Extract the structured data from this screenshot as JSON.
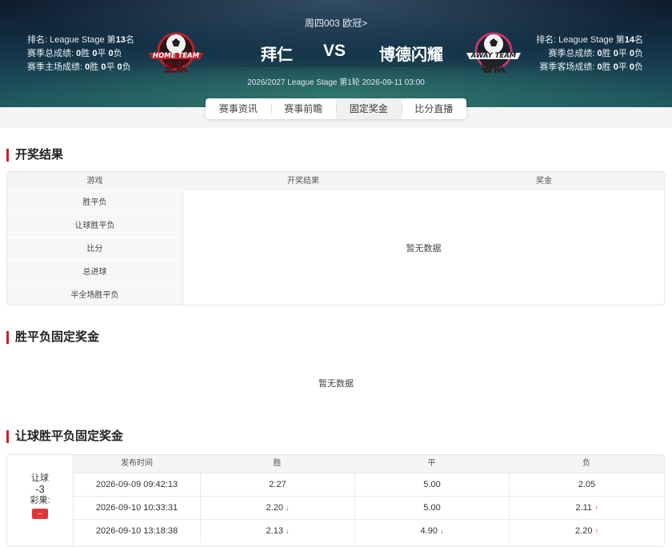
{
  "match": {
    "competition_line": "周四003 欧冠>",
    "home_team": "拜仁",
    "vs": "VS",
    "away_team": "博德闪耀",
    "date_line": "2026/2027 League Stage 第1轮 2026-09-11 03:00",
    "home_info": {
      "rank_prefix": "排名: League Stage 第",
      "rank": "13",
      "rank_suffix": "名",
      "season_label": "赛季总成绩: ",
      "season_w": "0",
      "season_d": "0",
      "season_l": "0",
      "venue_label": "赛季主场成绩: ",
      "venue_w": "0",
      "venue_d": "0",
      "venue_l": "0"
    },
    "away_info": {
      "rank_prefix": "排名: League Stage 第",
      "rank": "14",
      "rank_suffix": "名",
      "season_label": "赛季总成绩: ",
      "season_w": "0",
      "season_d": "0",
      "season_l": "0",
      "venue_label": "赛季客场成绩: ",
      "venue_w": "0",
      "venue_d": "0",
      "venue_l": "0"
    },
    "units": {
      "win": "胜",
      "draw": "平",
      "loss": "负"
    },
    "home_badge": {
      "top_text": "HOME TEAM",
      "main_text": "主队"
    },
    "away_badge": {
      "top_text": "AWAY TEAM",
      "main_text": "客队"
    }
  },
  "tabs": [
    {
      "label": "赛事资讯",
      "active": false
    },
    {
      "label": "赛事前瞻",
      "active": false
    },
    {
      "label": "固定奖金",
      "active": true
    },
    {
      "label": "比分直播",
      "active": false
    }
  ],
  "results_section": {
    "title": "开奖结果",
    "headers": [
      "游戏",
      "开奖结果",
      "奖金"
    ],
    "games": [
      "胜平负",
      "让球胜平负",
      "比分",
      "总进球",
      "半全场胜平负"
    ],
    "no_data": "暂无数据"
  },
  "wdl_section": {
    "title": "胜平负固定奖金",
    "no_data": "暂无数据"
  },
  "handicap_section": {
    "title": "让球胜平负固定奖金",
    "left": {
      "label": "让球",
      "value": "-3",
      "result_label": "彩果:",
      "result_value": "--"
    },
    "headers": [
      "发布时间",
      "胜",
      "平",
      "负"
    ],
    "rows": [
      {
        "time": "2026-09-09 09:42:13",
        "win": "2.27",
        "win_trend": "",
        "draw": "5.00",
        "draw_trend": "",
        "loss": "2.05",
        "loss_trend": ""
      },
      {
        "time": "2026-09-10 10:33:31",
        "win": "2.20",
        "win_trend": "down",
        "draw": "5.00",
        "draw_trend": "",
        "loss": "2.11",
        "loss_trend": "up"
      },
      {
        "time": "2026-09-10 13:18:38",
        "win": "2.13",
        "win_trend": "down",
        "draw": "4.90",
        "draw_trend": "down",
        "loss": "2.20",
        "loss_trend": "up"
      }
    ]
  },
  "colors": {
    "accent_red": "#c8202b",
    "up": "#e0373b",
    "down": "#2f6bd6"
  }
}
